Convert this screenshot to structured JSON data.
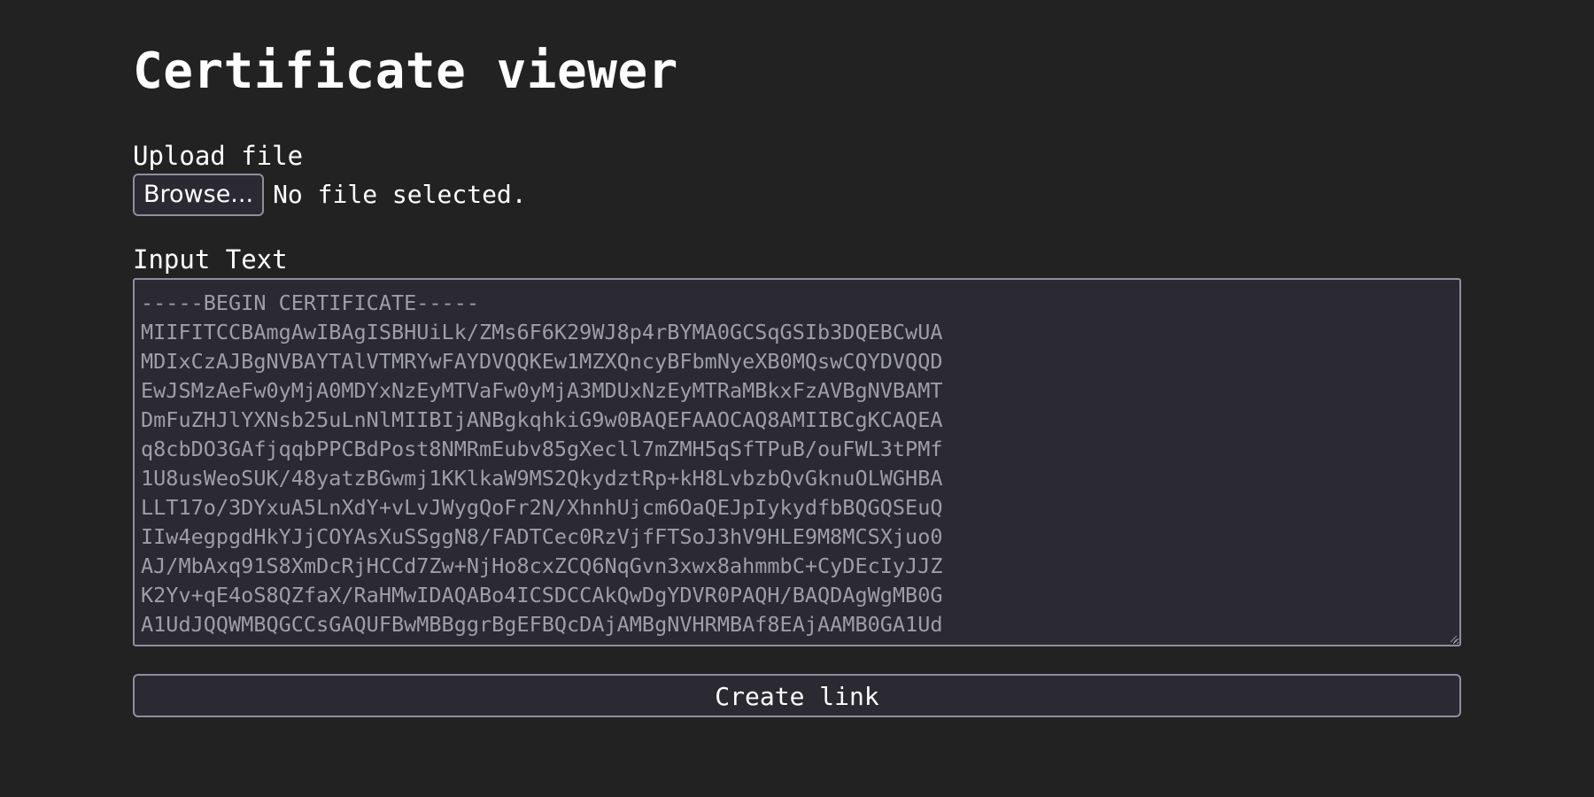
{
  "page": {
    "title": "Certificate viewer"
  },
  "upload": {
    "label": "Upload file",
    "browse_label": "Browse...",
    "status_text": "No file selected."
  },
  "input": {
    "label": "Input Text",
    "value": "-----BEGIN CERTIFICATE-----\nMIIFITCCBAmgAwIBAgISBHUiLk/ZMs6F6K29WJ8p4rBYMA0GCSqGSIb3DQEBCwUA\nMDIxCzAJBgNVBAYTAlVTMRYwFAYDVQQKEw1MZXQncyBFbmNyeXB0MQswCQYDVQQD\nEwJSMzAeFw0yMjA0MDYxNzEyMTVaFw0yMjA3MDUxNzEyMTRaMBkxFzAVBgNVBAMT\nDmFuZHJlYXNsb25uLnNlMIIBIjANBgkqhkiG9w0BAQEFAAOCAQ8AMIIBCgKCAQEA\nq8cbDO3GAfjqqbPPCBdPost8NMRmEubv85gXecll7mZMH5qSfTPuB/ouFWL3tPMf\n1U8usWeoSUK/48yatzBGwmj1KKlkaW9MS2QkydztRp+kH8LvbzbQvGknuOLWGHBA\nLLT17o/3DYxuA5LnXdY+vLvJWygQoFr2N/XhnhUjcm6OaQEJpIykydfbBQGQSEuQ\nIIw4egpgdHkYJjCOYAsXuSSggN8/FADTCec0RzVjfFTSoJ3hV9HLE9M8MCSXjuo0\nAJ/MbAxq91S8XmDcRjHCCd7Zw+NjHo8cxZCQ6NqGvn3xwx8ahmmbC+CyDEcIyJJZ\nK2Yv+qE4oS8QZfaX/RaHMwIDAQABo4ICSDCCAkQwDgYDVR0PAQH/BAQDAgWgMB0G\nA1UdJQQWMBQGCCsGAQUFBwMBBggrBgEFBQcDAjAMBgNVHRMBAf8EAjAAMB0GA1Ud"
  },
  "actions": {
    "create_link_label": "Create link"
  },
  "colors": {
    "background": "#222222",
    "control_background": "#2b2a33",
    "control_border": "#8f8f9d",
    "text": "#ffffff",
    "textarea_text": "#9e9ea6"
  },
  "icons": {
    "resize_grip": "resize-grip-icon"
  }
}
